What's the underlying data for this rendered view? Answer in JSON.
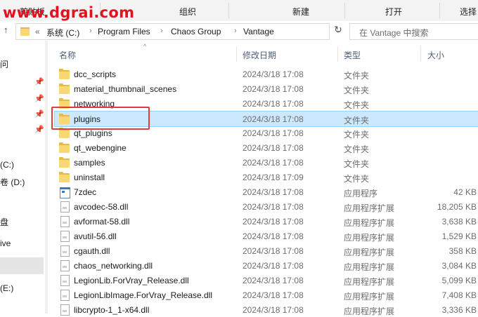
{
  "watermark": "www.dgrai.com",
  "ribbon": {
    "groups": [
      "剪贴板",
      "组织",
      "新建",
      "打开",
      "选择"
    ]
  },
  "navigation": {
    "back_icon": "back-arrow-icon",
    "up_icon": "up-arrow-icon",
    "breadcrumb_overflow": "«",
    "path": [
      "系统 (C:)",
      "Program Files",
      "Chaos Group",
      "Vantage"
    ],
    "dropdown_icon": "chevron-down-icon",
    "refresh_icon": "refresh-icon",
    "search_placeholder": "在 Vantage 中搜索"
  },
  "sidebar": {
    "fragments": [
      "问",
      "(C:)",
      "卷 (D:)",
      "盘",
      "ive",
      "(E:)"
    ],
    "pin_icon": "pin-icon"
  },
  "columns": {
    "name": "名称",
    "date": "修改日期",
    "type": "类型",
    "size": "大小"
  },
  "files": [
    {
      "name": "dcc_scripts",
      "date": "2024/3/18 17:08",
      "type": "文件夹",
      "size": "",
      "icon": "folder-icon"
    },
    {
      "name": "material_thumbnail_scenes",
      "date": "2024/3/18 17:08",
      "type": "文件夹",
      "size": "",
      "icon": "folder-icon"
    },
    {
      "name": "networking",
      "date": "2024/3/18 17:08",
      "type": "文件夹",
      "size": "",
      "icon": "folder-icon"
    },
    {
      "name": "plugins",
      "date": "2024/3/18 17:08",
      "type": "文件夹",
      "size": "",
      "icon": "folder-icon",
      "selected": true
    },
    {
      "name": "qt_plugins",
      "date": "2024/3/18 17:08",
      "type": "文件夹",
      "size": "",
      "icon": "folder-icon"
    },
    {
      "name": "qt_webengine",
      "date": "2024/3/18 17:08",
      "type": "文件夹",
      "size": "",
      "icon": "folder-icon"
    },
    {
      "name": "samples",
      "date": "2024/3/18 17:08",
      "type": "文件夹",
      "size": "",
      "icon": "folder-icon"
    },
    {
      "name": "uninstall",
      "date": "2024/3/18 17:09",
      "type": "文件夹",
      "size": "",
      "icon": "folder-icon"
    },
    {
      "name": "7zdec",
      "date": "2024/3/18 17:08",
      "type": "应用程序",
      "size": "42 KB",
      "icon": "app-icon"
    },
    {
      "name": "avcodec-58.dll",
      "date": "2024/3/18 17:08",
      "type": "应用程序扩展",
      "size": "18,205 KB",
      "icon": "dll-file-icon"
    },
    {
      "name": "avformat-58.dll",
      "date": "2024/3/18 17:08",
      "type": "应用程序扩展",
      "size": "3,638 KB",
      "icon": "dll-file-icon"
    },
    {
      "name": "avutil-56.dll",
      "date": "2024/3/18 17:08",
      "type": "应用程序扩展",
      "size": "1,529 KB",
      "icon": "dll-file-icon"
    },
    {
      "name": "cgauth.dll",
      "date": "2024/3/18 17:08",
      "type": "应用程序扩展",
      "size": "358 KB",
      "icon": "dll-file-icon"
    },
    {
      "name": "chaos_networking.dll",
      "date": "2024/3/18 17:08",
      "type": "应用程序扩展",
      "size": "3,084 KB",
      "icon": "dll-file-icon"
    },
    {
      "name": "LegionLib.ForVray_Release.dll",
      "date": "2024/3/18 17:08",
      "type": "应用程序扩展",
      "size": "5,099 KB",
      "icon": "dll-file-icon"
    },
    {
      "name": "LegionLibImage.ForVray_Release.dll",
      "date": "2024/3/18 17:08",
      "type": "应用程序扩展",
      "size": "7,408 KB",
      "icon": "dll-file-icon"
    },
    {
      "name": "libcrypto-1_1-x64.dll",
      "date": "2024/3/18 17:08",
      "type": "应用程序扩展",
      "size": "3,336 KB",
      "icon": "dll-file-icon"
    }
  ],
  "colors": {
    "selection_bg": "#cce8ff",
    "highlight_box": "#e03c3c",
    "watermark": "#e0141e",
    "folder": "#f8d775"
  }
}
